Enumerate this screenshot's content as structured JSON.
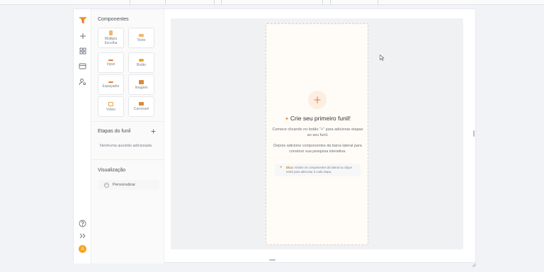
{
  "colors": {
    "accent": "#f07c2c",
    "avatar": "#f5a524"
  },
  "rail": {
    "icons": [
      "funnel-logo-icon",
      "plus-icon",
      "grid-icon",
      "card-icon",
      "user-settings-icon",
      "help-icon",
      "expand-icon"
    ],
    "avatar_letter": "A"
  },
  "sidebar": {
    "components_title": "Componentes",
    "components": [
      {
        "label": "Múltipla Escolha",
        "icon": "list-icon"
      },
      {
        "label": "Texto",
        "icon": "text-icon"
      },
      {
        "label": "Input",
        "icon": "input-icon"
      },
      {
        "label": "Botão",
        "icon": "button-icon"
      },
      {
        "label": "Espaçador",
        "icon": "spacer-icon"
      },
      {
        "label": "Imagem",
        "icon": "image-icon"
      },
      {
        "label": "Vídeo",
        "icon": "video-icon"
      },
      {
        "label": "Carrossel",
        "icon": "carousel-icon"
      }
    ],
    "steps_title": "Etapas do funil",
    "steps_empty": "Nenhuma questão adicionada",
    "visual_title": "Visualização",
    "customize_label": "Personalizar"
  },
  "editor": {
    "title": "Crie seu primeiro funil!",
    "line1": "Comece clicando no botão \"+\" para adicionar etapas ao seu funil.",
    "line2": "Depois adicione componentes da barra lateral para construir sua pesquisa interativa.",
    "tip_label": "Dica:",
    "tip_text": "Arraste os componentes da lateral ou clique neles para adicionar à cada etapa."
  }
}
